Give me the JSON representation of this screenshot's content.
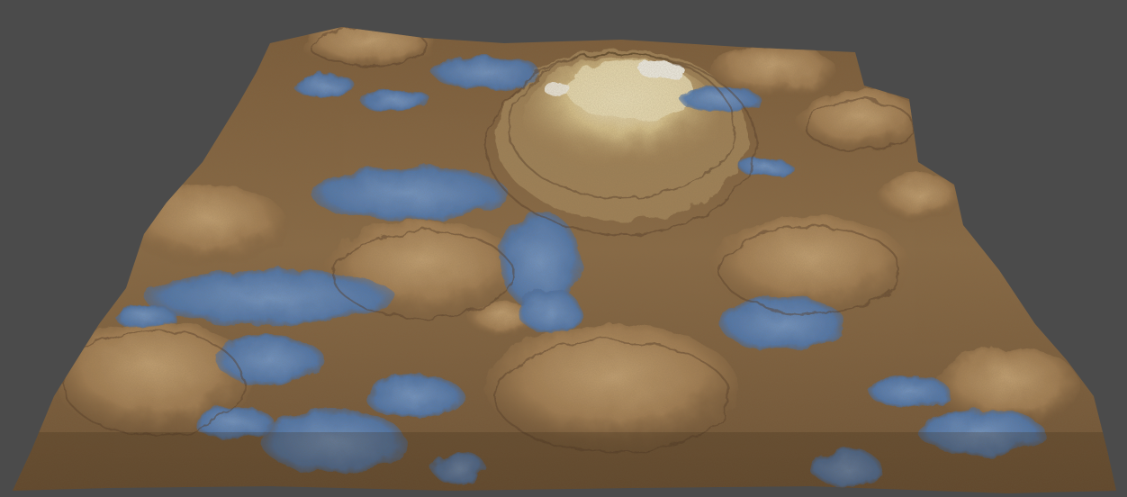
{
  "viewport": {
    "background_color": "#4b4b4b",
    "subject": "terrain-heightmap-render"
  },
  "palette": {
    "dirt": "#8a6a45",
    "dirt_dark": "#5a4128",
    "dirt_light": "#b99466",
    "peak": "#e8d9a8",
    "snow": "#f2f0e6",
    "water": "#4a78b8",
    "water_light": "#6f9ad4"
  }
}
